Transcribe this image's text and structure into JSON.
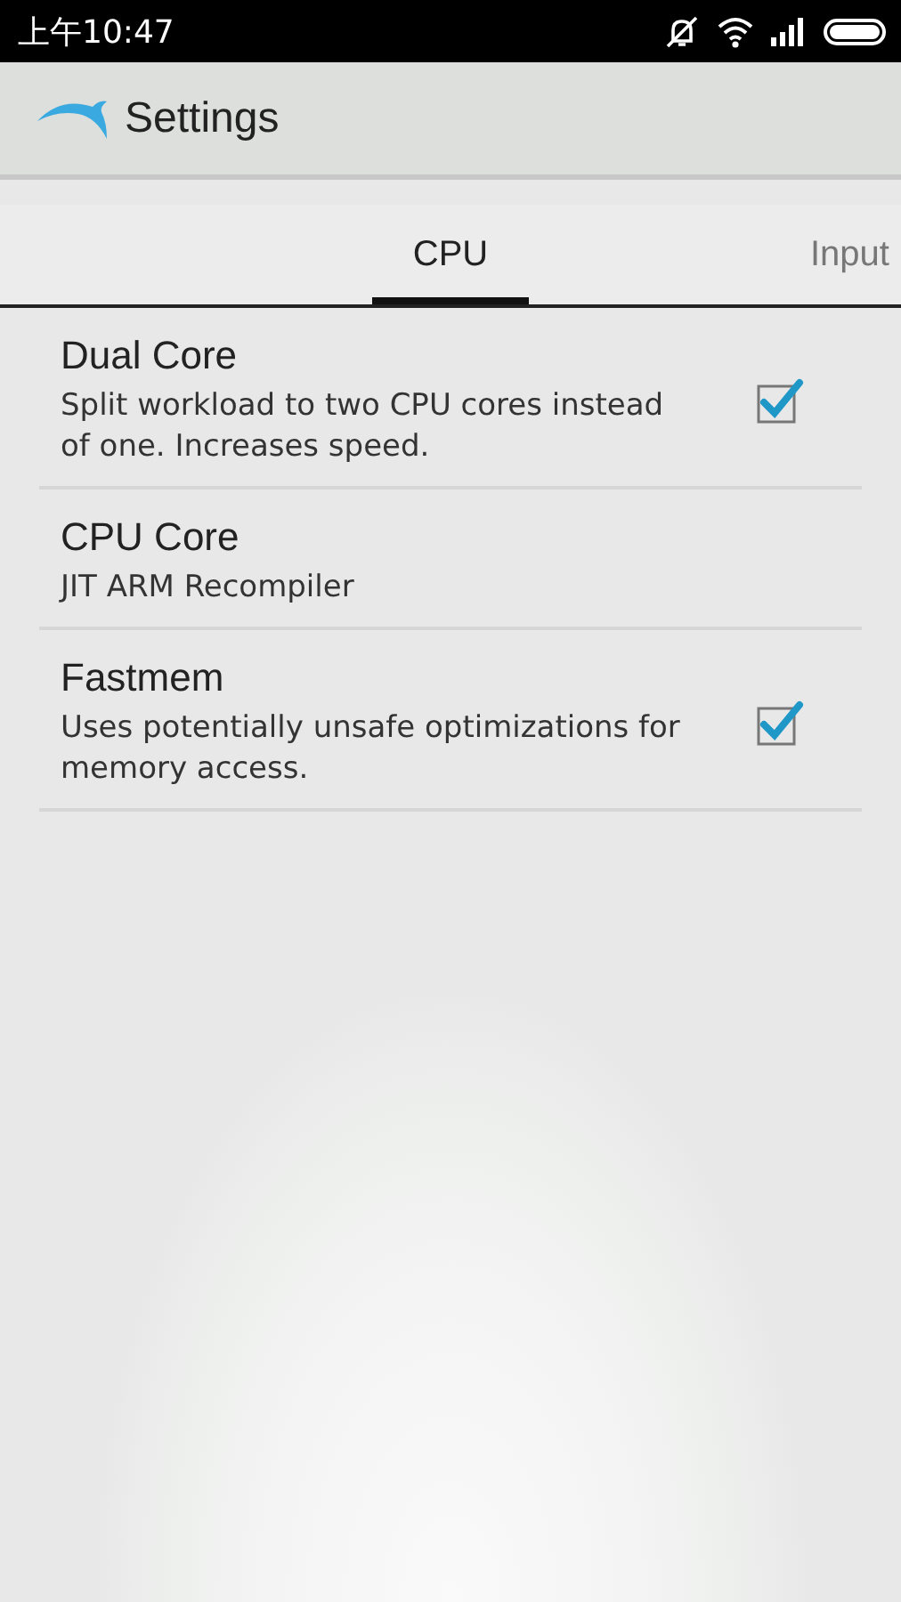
{
  "status_bar": {
    "time": "上午10:47"
  },
  "app_bar": {
    "title": "Settings"
  },
  "tabs": [
    {
      "label": "CPU",
      "selected": true
    },
    {
      "label": "Input",
      "selected": false
    }
  ],
  "settings": [
    {
      "kind": "checkbox",
      "title": "Dual Core",
      "summary": "Split workload to two CPU cores instead of one. Increases speed.",
      "checked": true
    },
    {
      "kind": "text",
      "title": "CPU Core",
      "summary": "JIT ARM Recompiler"
    },
    {
      "kind": "checkbox",
      "title": "Fastmem",
      "summary": "Uses potentially unsafe optimizations for memory access.",
      "checked": true
    }
  ]
}
